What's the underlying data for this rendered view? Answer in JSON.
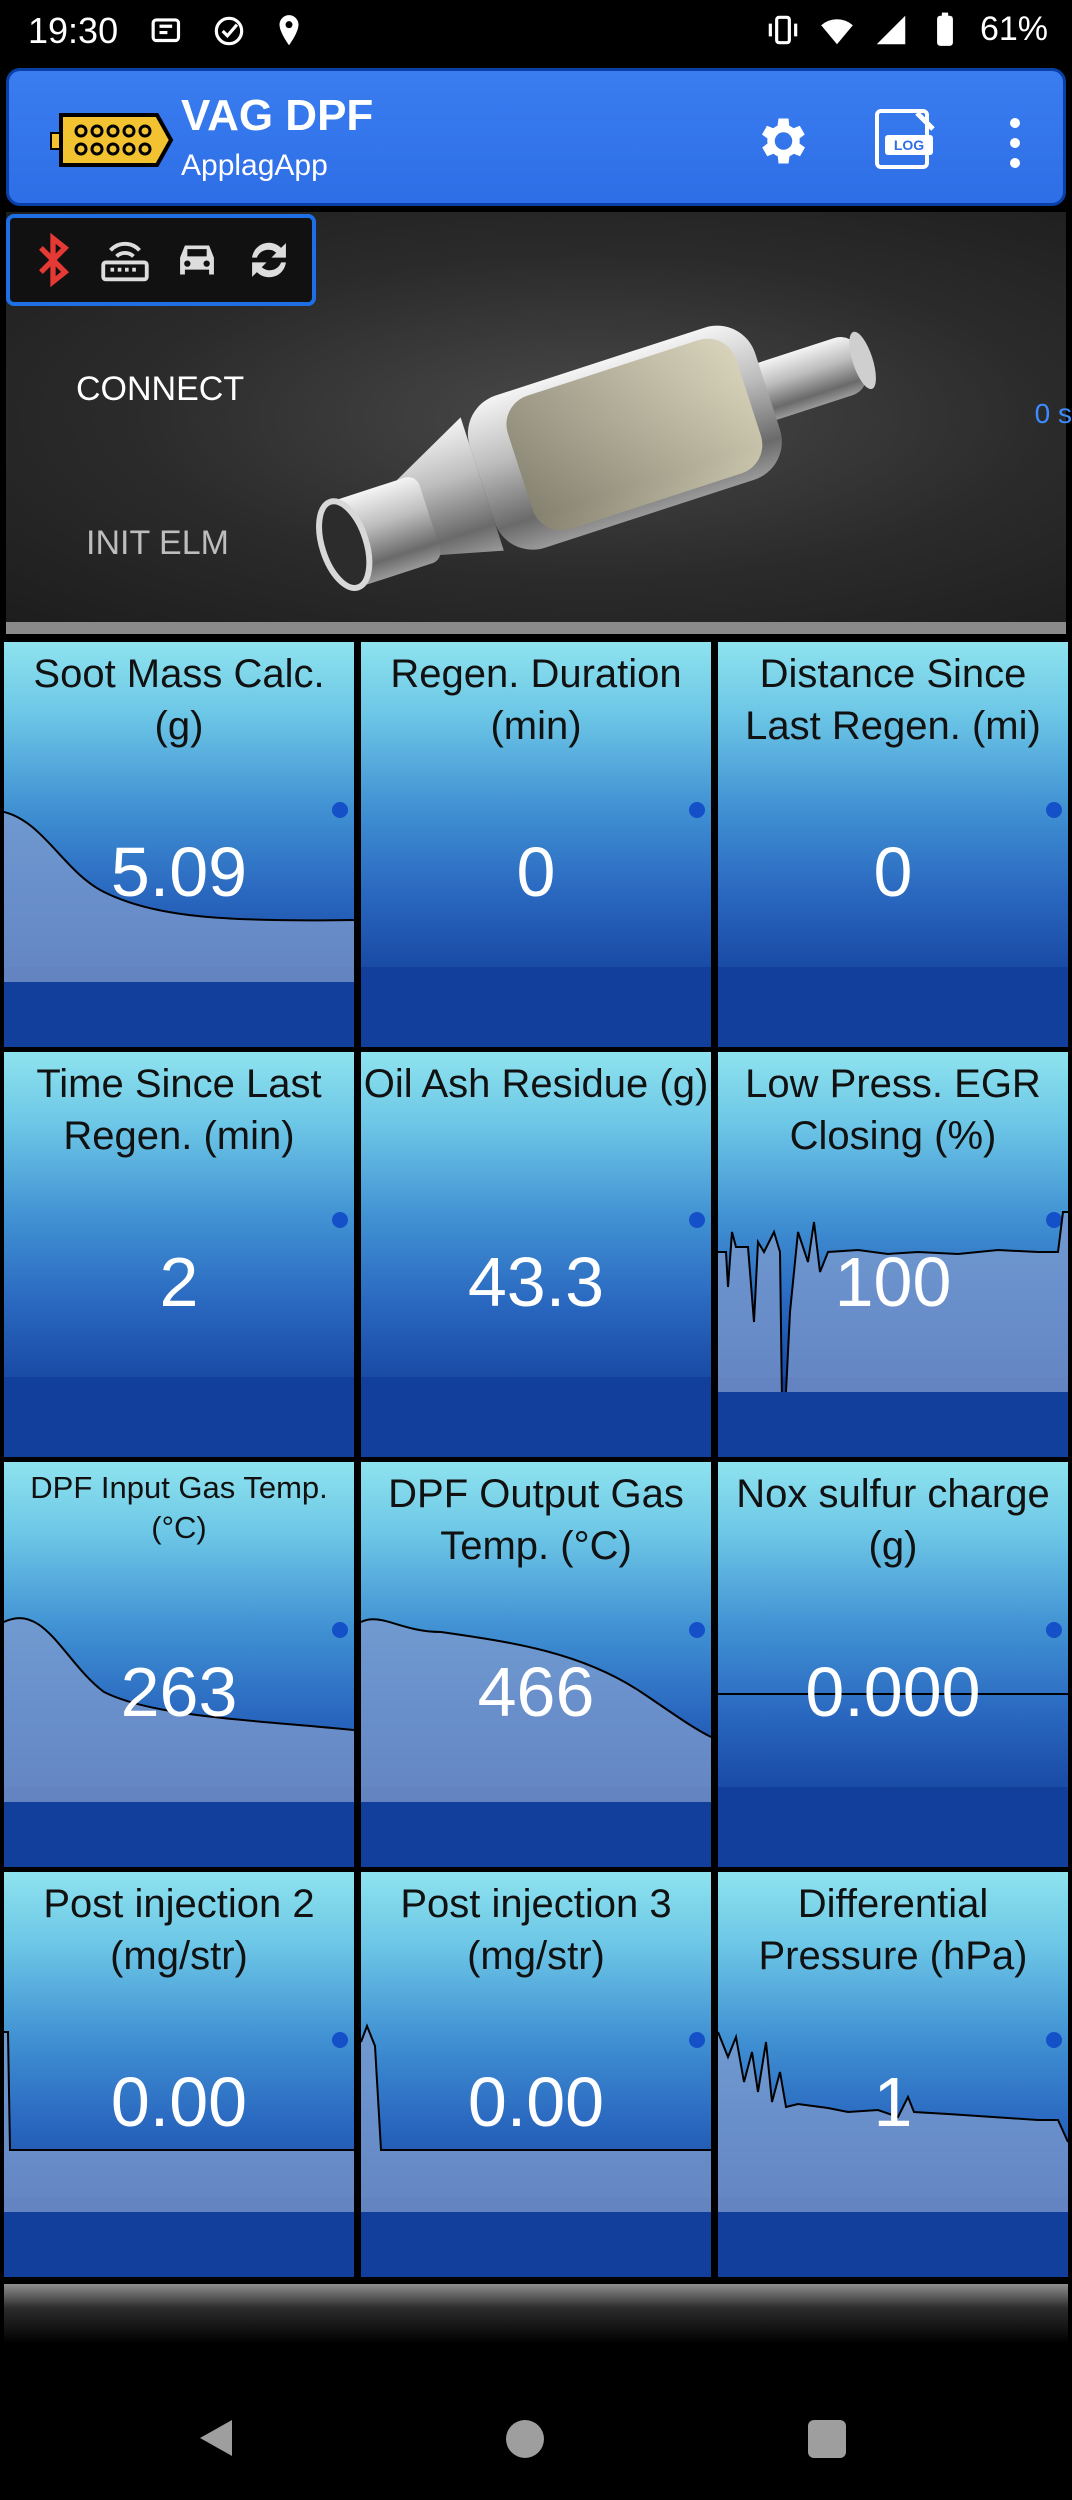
{
  "status_bar": {
    "time": "19:30",
    "battery": "61%"
  },
  "app_bar": {
    "title": "VAG DPF",
    "subtitle": "ApplagApp",
    "log_label": "LOG"
  },
  "banner": {
    "connect": "CONNECT",
    "init_elm": "INIT ELM",
    "timer": "0 s"
  },
  "tiles": [
    {
      "label": "Soot Mass Calc. (g)",
      "value": "5.09"
    },
    {
      "label": "Regen. Duration (min)",
      "value": "0"
    },
    {
      "label": "Distance Since Last Regen. (mi)",
      "value": "0"
    },
    {
      "label": "Time Since Last Regen. (min)",
      "value": "2"
    },
    {
      "label": "Oil Ash Residue (g)",
      "value": "43.3"
    },
    {
      "label": "Low Press. EGR Closing (%)",
      "value": "100"
    },
    {
      "label": "DPF Input Gas Temp. (°C)",
      "value": "263"
    },
    {
      "label": "DPF Output Gas Temp. (°C)",
      "value": "466"
    },
    {
      "label": "Nox sulfur charge (g)",
      "value": "0.000"
    },
    {
      "label": "Post injection 2 (mg/str)",
      "value": "0.00"
    },
    {
      "label": "Post injection 3 (mg/str)",
      "value": "0.00"
    },
    {
      "label": "Differential Pressure (hPa)",
      "value": "1"
    }
  ]
}
